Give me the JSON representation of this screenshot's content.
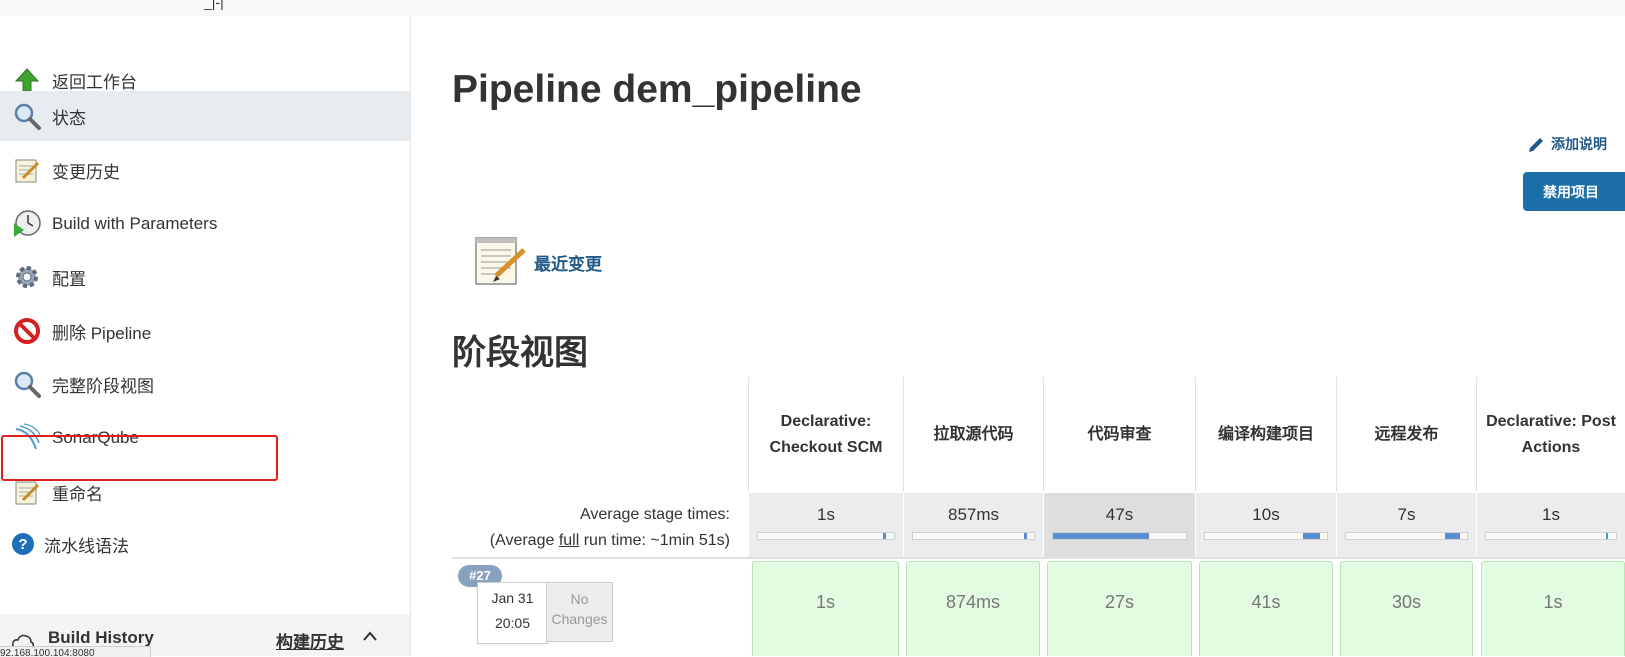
{
  "topbar": {
    "glyph": "_|-|"
  },
  "sidebar": {
    "items": [
      {
        "label": "返回工作台",
        "icon": "up-arrow-icon"
      },
      {
        "label": "状态",
        "icon": "magnifier-icon"
      },
      {
        "label": "变更历史",
        "icon": "notepad-icon"
      },
      {
        "label": "Build with Parameters",
        "icon": "clock-play-icon"
      },
      {
        "label": "配置",
        "icon": "gear-icon"
      },
      {
        "label": "删除 Pipeline",
        "icon": "no-entry-icon"
      },
      {
        "label": "完整阶段视图",
        "icon": "magnifier-icon"
      },
      {
        "label": "SonarQube",
        "icon": "sonarqube-icon"
      },
      {
        "label": "重命名",
        "icon": "notepad-icon"
      },
      {
        "label": "流水线语法",
        "icon": "help-icon"
      }
    ],
    "build_history": {
      "label": "Build History",
      "label_cn": "构建历史",
      "caret": "^"
    },
    "statusbar_text": "92.168.100.104:8080"
  },
  "main": {
    "title": "Pipeline dem_pipeline",
    "add_description": "添加说明",
    "disable_button": "禁用项目",
    "recent_changes": "最近变更",
    "stage_view_title": "阶段视图"
  },
  "stage_view": {
    "avg_label": "Average stage times:",
    "avg_full_prefix": "(Average ",
    "avg_full_link": "full",
    "avg_full_suffix": " run time: ~1min 51s)",
    "stages": [
      {
        "name": "Declarative: Checkout SCM",
        "avg": "1s",
        "fill": 0.02
      },
      {
        "name": "拉取源代码",
        "avg": "857ms",
        "fill": 0.02
      },
      {
        "name": "代码审查",
        "avg": "47s",
        "fill": 0.72
      },
      {
        "name": "编译构建项目",
        "avg": "10s",
        "fill": 0.14
      },
      {
        "name": "远程发布",
        "avg": "7s",
        "fill": 0.12
      },
      {
        "name": "Declarative: Post Actions",
        "avg": "1s",
        "fill": 0.02
      }
    ],
    "builds": [
      {
        "number": "#27",
        "date": "Jan 31",
        "time": "20:05",
        "changes": "No Changes",
        "durations": [
          "1s",
          "874ms",
          "27s",
          "41s",
          "30s",
          "1s"
        ]
      }
    ]
  },
  "colors": {
    "accent": "#1c6fa8",
    "link": "#1f5a8a",
    "success_cell": "#e2fce2",
    "highlight": "#e02020"
  }
}
